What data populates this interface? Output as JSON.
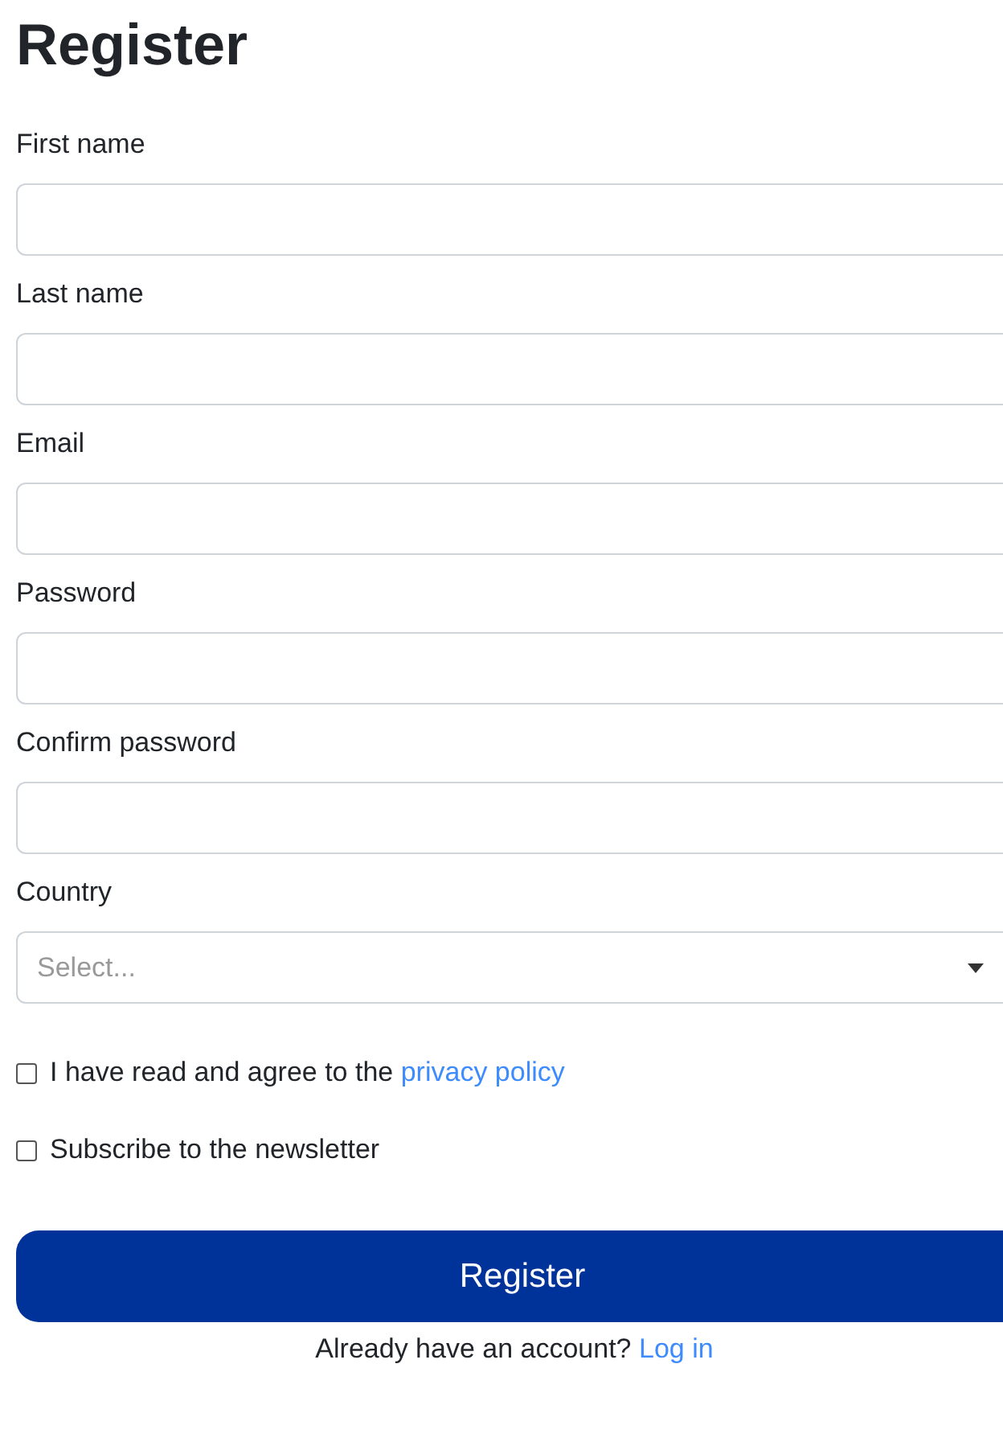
{
  "title": "Register",
  "fields": [
    {
      "label": "First name",
      "kind": "text"
    },
    {
      "label": "Last name",
      "kind": "text"
    },
    {
      "label": "Email",
      "kind": "text"
    },
    {
      "label": "Password",
      "kind": "text"
    },
    {
      "label": "Confirm password",
      "kind": "text"
    },
    {
      "label": "Country",
      "kind": "select",
      "placeholder": "Select..."
    }
  ],
  "checkboxes": [
    {
      "text": "I have read and agree to the",
      "link": "privacy policy",
      "checked": false
    },
    {
      "text": "Subscribe to the newsletter",
      "checked": false
    }
  ],
  "submit": "Register",
  "footer": {
    "text": "Already have an account?",
    "link": "Log in"
  }
}
